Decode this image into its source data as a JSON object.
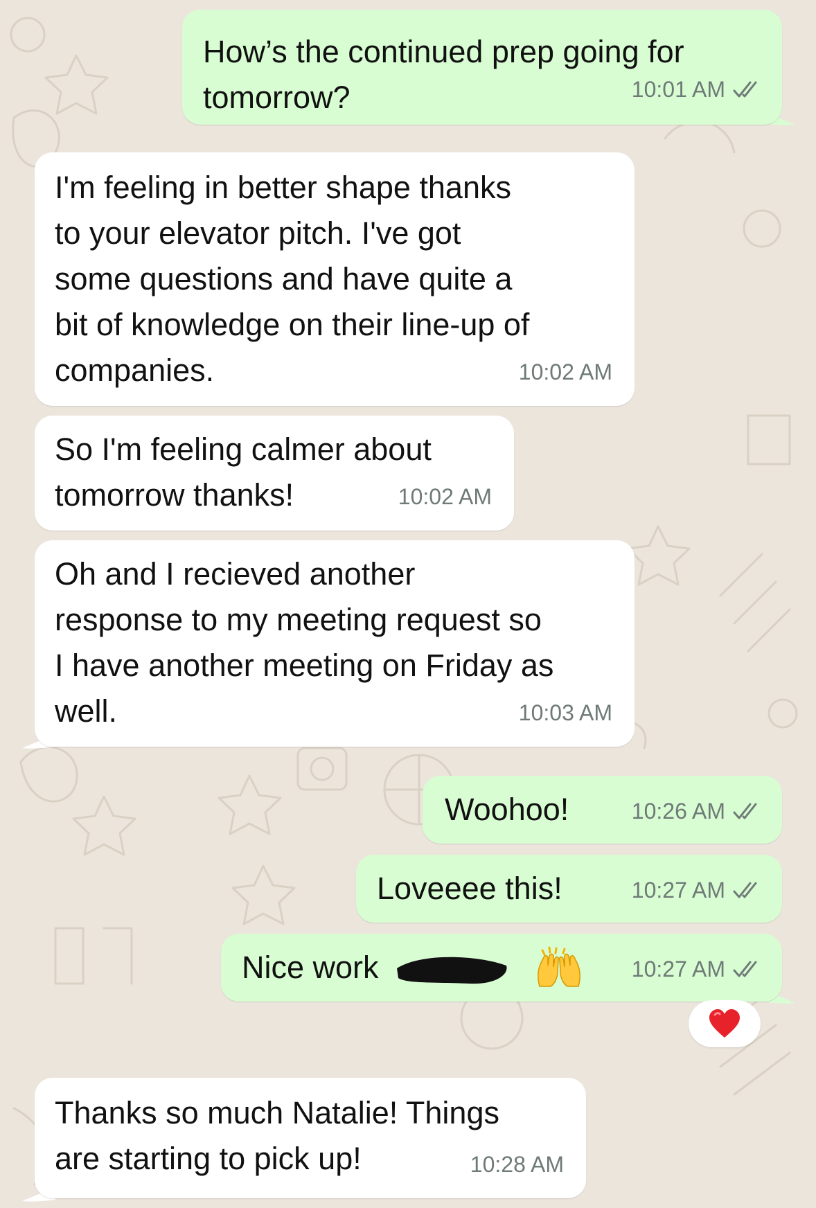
{
  "colors": {
    "outgoing_bubble": "#d9fdd3",
    "incoming_bubble": "#ffffff",
    "background": "#ece5dc",
    "timestamp": "#6e7a77",
    "read_ticks": "#6e7a77"
  },
  "messages": [
    {
      "direction": "outgoing",
      "text": "How’s the continued prep going for\ntomorrow?",
      "time": "10:01 AM",
      "status": "read"
    },
    {
      "direction": "incoming",
      "text": "I'm feeling in better shape thanks\nto your elevator pitch. I've got\nsome questions and have quite a\nbit of knowledge on their line-up of\ncompanies.",
      "time": "10:02 AM"
    },
    {
      "direction": "incoming",
      "text": "So I'm feeling calmer about\ntomorrow thanks!",
      "time": "10:02 AM"
    },
    {
      "direction": "incoming",
      "text": "Oh and I recieved another\nresponse to my meeting request so\nI have another meeting on Friday as\nwell.",
      "time": "10:03 AM"
    },
    {
      "direction": "outgoing",
      "text": "Woohoo!",
      "time": "10:26 AM",
      "status": "read"
    },
    {
      "direction": "outgoing",
      "text": "Loveeee this!",
      "time": "10:27 AM",
      "status": "read"
    },
    {
      "direction": "outgoing",
      "text": "Nice work",
      "time": "10:27 AM",
      "status": "read",
      "redacted_name": true,
      "emoji": "raising-hands-icon",
      "reaction": "red-heart-icon"
    },
    {
      "direction": "incoming",
      "text": "Thanks so much Natalie! Things\nare starting to pick up!",
      "time": "10:28 AM"
    }
  ],
  "icons": {
    "read_status": "double-check-icon",
    "reaction": "red-heart-icon",
    "emoji": "raising-hands-icon"
  }
}
